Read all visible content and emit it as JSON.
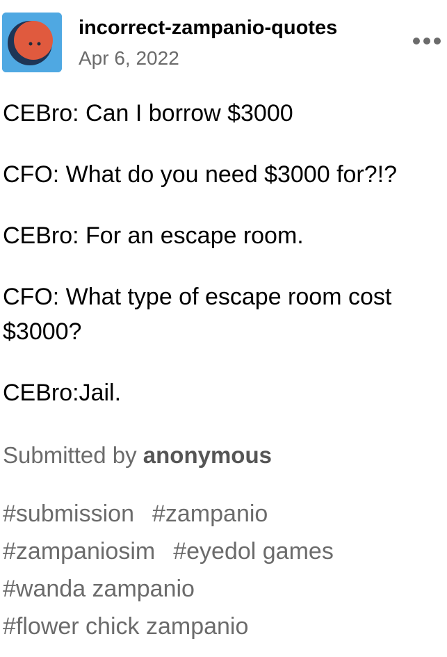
{
  "post": {
    "blog_name": "incorrect-zampanio-quotes",
    "date": "Apr 6, 2022",
    "avatar_icon": "avatar-round-face-icon",
    "more_icon": "more-dots-icon",
    "lines": [
      "CEBro: Can I borrow $3000",
      "CFO: What do you need $3000 for?!?",
      "CEBro: For an escape room.",
      "CFO: What type of escape room cost $3000?",
      "CEBro:Jail."
    ],
    "submitted_prefix": "Submitted by ",
    "submitter": "anonymous",
    "tags": [
      "#submission",
      "#zampanio",
      "#zampaniosim",
      "#eyedol games",
      "#wanda zampanio",
      "#flower chick zampanio"
    ]
  },
  "colors": {
    "avatar_bg": "#4fa8e2",
    "avatar_face": "#e05a3e",
    "muted_text": "#6b6b6b"
  }
}
